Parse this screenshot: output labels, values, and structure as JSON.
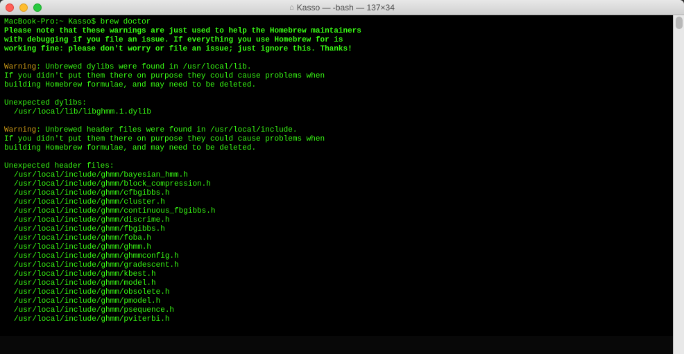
{
  "window": {
    "title": "Kasso — -bash — 137×34"
  },
  "prompt": {
    "host": "MacBook-Pro",
    "cwd": "Kasso",
    "sep": ":~ ",
    "dollar": "$ ",
    "command": "brew doctor"
  },
  "note": {
    "line1": "Please note that these warnings are just used to help the Homebrew maintainers",
    "line2": "with debugging if you file an issue. If everything you use Homebrew for is",
    "line3": "working fine: please don't worry or file an issue; just ignore this. Thanks!"
  },
  "warning1": {
    "label": "Warning",
    "msg": ": Unbrewed dylibs were found in /usr/local/lib.",
    "detail1": "If you didn't put them there on purpose they could cause problems when",
    "detail2": "building Homebrew formulae, and may need to be deleted.",
    "header": "Unexpected dylibs:",
    "items": [
      "/usr/local/lib/libghmm.1.dylib"
    ]
  },
  "warning2": {
    "label": "Warning",
    "msg": ": Unbrewed header files were found in /usr/local/include.",
    "detail1": "If you didn't put them there on purpose they could cause problems when",
    "detail2": "building Homebrew formulae, and may need to be deleted.",
    "header": "Unexpected header files:",
    "items": [
      "/usr/local/include/ghmm/bayesian_hmm.h",
      "/usr/local/include/ghmm/block_compression.h",
      "/usr/local/include/ghmm/cfbgibbs.h",
      "/usr/local/include/ghmm/cluster.h",
      "/usr/local/include/ghmm/continuous_fbgibbs.h",
      "/usr/local/include/ghmm/discrime.h",
      "/usr/local/include/ghmm/fbgibbs.h",
      "/usr/local/include/ghmm/foba.h",
      "/usr/local/include/ghmm/ghmm.h",
      "/usr/local/include/ghmm/ghmmconfig.h",
      "/usr/local/include/ghmm/gradescent.h",
      "/usr/local/include/ghmm/kbest.h",
      "/usr/local/include/ghmm/model.h",
      "/usr/local/include/ghmm/obsolete.h",
      "/usr/local/include/ghmm/pmodel.h",
      "/usr/local/include/ghmm/psequence.h",
      "/usr/local/include/ghmm/pviterbi.h"
    ]
  }
}
